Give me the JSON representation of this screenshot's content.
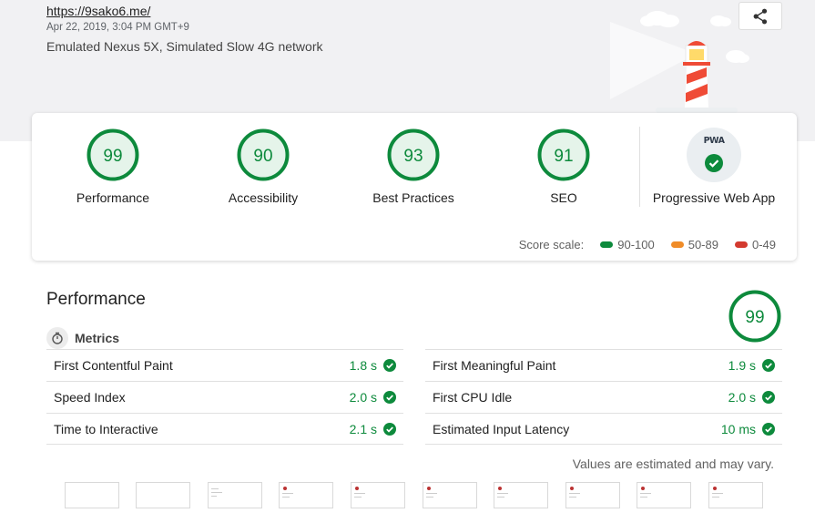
{
  "header": {
    "url": "https://9sako6.me/",
    "date": "Apr 22, 2019, 3:04 PM GMT+9",
    "environment": "Emulated Nexus 5X, Simulated Slow 4G network"
  },
  "categories": [
    {
      "score": "99",
      "label": "Performance"
    },
    {
      "score": "90",
      "label": "Accessibility"
    },
    {
      "score": "93",
      "label": "Best Practices"
    },
    {
      "score": "91",
      "label": "SEO"
    }
  ],
  "pwa": {
    "badge_text": "PWA",
    "label": "Progressive Web App"
  },
  "score_scale": {
    "title": "Score scale:",
    "ranges": [
      {
        "label": "90-100",
        "color": "#0d8a3c"
      },
      {
        "label": "50-89",
        "color": "#f08c28"
      },
      {
        "label": "0-49",
        "color": "#d33a2f"
      }
    ]
  },
  "performance": {
    "title": "Performance",
    "score": "99",
    "metrics_title": "Metrics",
    "metrics_left": [
      {
        "name": "First Contentful Paint",
        "value": "1.8 s"
      },
      {
        "name": "Speed Index",
        "value": "2.0 s"
      },
      {
        "name": "Time to Interactive",
        "value": "2.1 s"
      }
    ],
    "metrics_right": [
      {
        "name": "First Meaningful Paint",
        "value": "1.9 s"
      },
      {
        "name": "First CPU Idle",
        "value": "2.0 s"
      },
      {
        "name": "Estimated Input Latency",
        "value": "10 ms"
      }
    ],
    "note": "Values are estimated and may vary."
  },
  "colors": {
    "pass": "#0d8a3c",
    "ring_track": "#e5f4ea"
  }
}
